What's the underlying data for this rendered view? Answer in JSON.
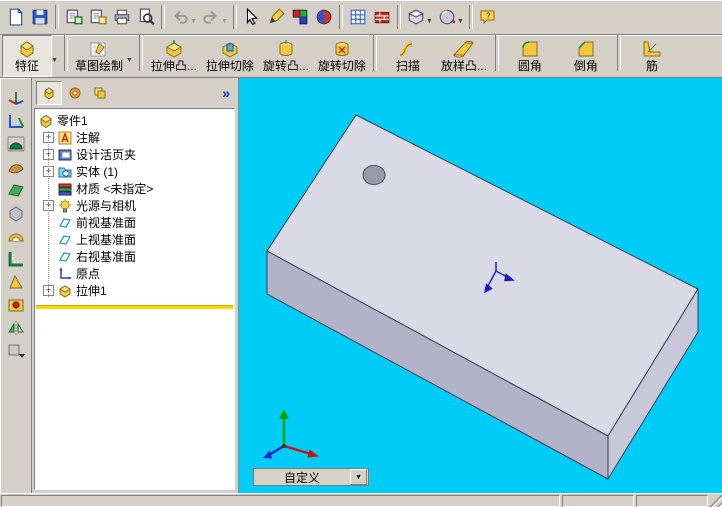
{
  "glyphs": {
    "plus": "+",
    "collapse_chevrons": "»",
    "dropdown": "▼",
    "question": "?"
  },
  "top_toolbar": {
    "icons": [
      "new-document",
      "save",
      "make-drawing-from-part",
      "make-assembly-from-part",
      "print",
      "print-preview",
      "undo",
      "redo",
      "select-arrow",
      "sketch-pencil",
      "color-swatch",
      "render-sphere",
      "grid-table",
      "bricks",
      "view-orientation-dropdown",
      "display-style-dropdown",
      "help-bubble"
    ]
  },
  "feature_bar": {
    "modes": [
      {
        "label": "特征"
      },
      {
        "label": "草图绘制"
      }
    ],
    "tools": [
      {
        "label": "拉伸凸..."
      },
      {
        "label": "拉伸切除"
      },
      {
        "label": "旋转凸..."
      },
      {
        "label": "旋转切除"
      },
      {
        "label": "扫描"
      },
      {
        "label": "放样凸..."
      },
      {
        "label": "圆角"
      },
      {
        "label": "倒角"
      },
      {
        "label": "筋"
      }
    ]
  },
  "left_toolbar": {
    "icons": [
      "axes-3d",
      "coordinate-system",
      "dome",
      "freeform",
      "surface",
      "deform",
      "shell",
      "measure",
      "draft",
      "hole-wizard",
      "mirror",
      "more-features-dropdown"
    ]
  },
  "feature_tree": {
    "header_tabs": [
      "feature-manager",
      "property-manager",
      "configuration-manager"
    ],
    "root": {
      "label": "零件1"
    },
    "items": [
      {
        "label": "注解",
        "expandable": true
      },
      {
        "label": "设计活页夹",
        "expandable": true
      },
      {
        "label": "实体 (1)",
        "expandable": true
      },
      {
        "label": "材质 <未指定>",
        "expandable": false
      },
      {
        "label": "光源与相机",
        "expandable": true
      },
      {
        "label": "前视基准面",
        "expandable": false
      },
      {
        "label": "上视基准面",
        "expandable": false
      },
      {
        "label": "右视基准面",
        "expandable": false
      },
      {
        "label": "原点",
        "expandable": false
      },
      {
        "label": "拉伸1",
        "expandable": true
      }
    ]
  },
  "viewport": {
    "view_selector_value": "自定义"
  },
  "colors": {
    "chrome": "#d4d0c8",
    "viewport_bg": "#00ccf8",
    "model_top_face": "#dadae6",
    "model_front_face": "#b2b2c8",
    "model_end_face": "#c8c8da",
    "rollback_bar": "#f4d800",
    "accent_gold": "#f2c83e"
  }
}
